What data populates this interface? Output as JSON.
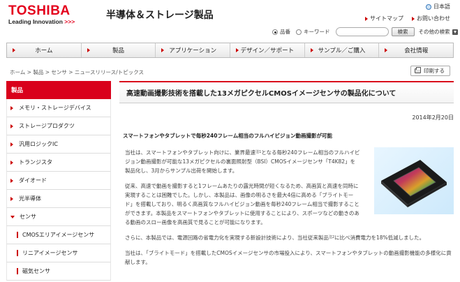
{
  "header": {
    "logo_brand": "TOSHIBA",
    "logo_tag_text": "Leading Innovation",
    "logo_tag_marks": ">>>",
    "site_title": "半導体＆ストレージ製品",
    "language": "日本語",
    "links": [
      "サイトマップ",
      "お問い合わせ"
    ]
  },
  "search": {
    "option_all": "品番",
    "option_keyword": "キーワード",
    "selected": "品番",
    "input_value": "",
    "button_label": "検索",
    "other_search": "その他の検索"
  },
  "nav": {
    "items": [
      "ホーム",
      "製品",
      "アプリケーション",
      "デザイン／サポート",
      "サンプル／ご購入",
      "会社情報"
    ]
  },
  "breadcrumb": "ホーム > 製品 > センサ > ニュースリリース/トピックス",
  "print_label": "印刷する",
  "sidebar": {
    "title": "製品",
    "items": [
      "メモリ・ストレージデバイス",
      "ストレージプロダクツ",
      "汎用ロジックIC",
      "トランジスタ",
      "ダイオード",
      "光半導体",
      "センサ"
    ],
    "sub_items": [
      "CMOSエリアイメージセンサ",
      "リニアイメージセンサ",
      "磁気センサ"
    ]
  },
  "article": {
    "title": "高速動画撮影技術を搭載した13メガピクセルCMOSイメージセンサの製品化について",
    "date": "2014年2月20日",
    "subheading": "スマートフォンやタブレットで毎秒240フレーム相当のフルハイビジョン動画撮影が可能",
    "p1_a": "当社は、スマートフォンやタブレット向けに、業界最速",
    "p1_note": "注1",
    "p1_b": "となる毎秒240フレーム相当のフルハイビジョン動画撮影が可能な13メガピクセルの裏面照射型（BSI）CMOSイメージセンサ「T4K82」を製品化し、3月からサンプル出荷を開始します。",
    "p2": "従来、高速で動画を撮影すると1フレームあたりの露光時間が短くなるため、高画質と高速を同時に実現することは困難でした。しかし、本製品は、画像の明るさを最大4倍に高める「ブライトモード」を搭載しており、明るく高画質なフルハイビジョン動画を毎秒240フレーム相当で撮影することができます。本製品をスマートフォンやタブレットに使用することにより、スポーツなどの動きのある動画のスロー画像を高画質で見ることが可能になります。",
    "p3_a": "さらに、本製品では、電源回路の省電力化を実現する新設計技術により、当社従来製品",
    "p3_note": "注2",
    "p3_b": "に比べ消費電力を18%低減しました。",
    "p4": "当社は、「ブライトモード」を搭載したCMOSイメージセンサの市場投入により、スマートフォンやタブレットの動画撮影機能の多様化に貢献します。"
  },
  "colors": {
    "accent": "#d9001b",
    "brand": "#e4001c"
  }
}
